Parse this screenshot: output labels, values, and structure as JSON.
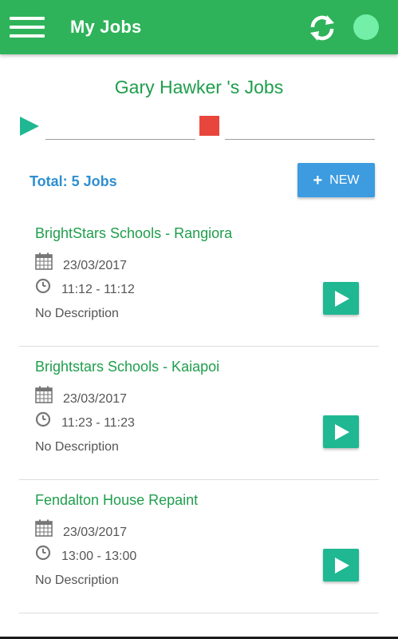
{
  "app_bar": {
    "title": "My Jobs",
    "color": "#2fb35a",
    "icons": [
      "menu-icon",
      "refresh-icon",
      "status-dot"
    ]
  },
  "header": {
    "user_jobs_title": "Gary Hawker 's Jobs"
  },
  "timer": {
    "start_value": "",
    "end_value": ""
  },
  "summary": {
    "total_label": "Total: 5 Jobs",
    "new_button_icon": "+",
    "new_button_label": "NEW"
  },
  "jobs": [
    {
      "title": "BrightStars Schools - Rangiora",
      "date": "23/03/2017",
      "time": "11:12 - 11:12",
      "description": "No Description"
    },
    {
      "title": "Brightstars Schools - Kaiapoi",
      "date": "23/03/2017",
      "time": "11:23 - 11:23",
      "description": "No Description"
    },
    {
      "title": "Fendalton House Repaint",
      "date": "23/03/2017",
      "time": "13:00 - 13:00",
      "description": "No Description"
    }
  ],
  "colors": {
    "primary": "#2fb35a",
    "job_title": "#1e9e4c",
    "accent_teal": "#1fb892",
    "stop_red": "#e8463c",
    "new_button_blue": "#3d9be0",
    "total_text_blue": "#2e8fcf"
  }
}
